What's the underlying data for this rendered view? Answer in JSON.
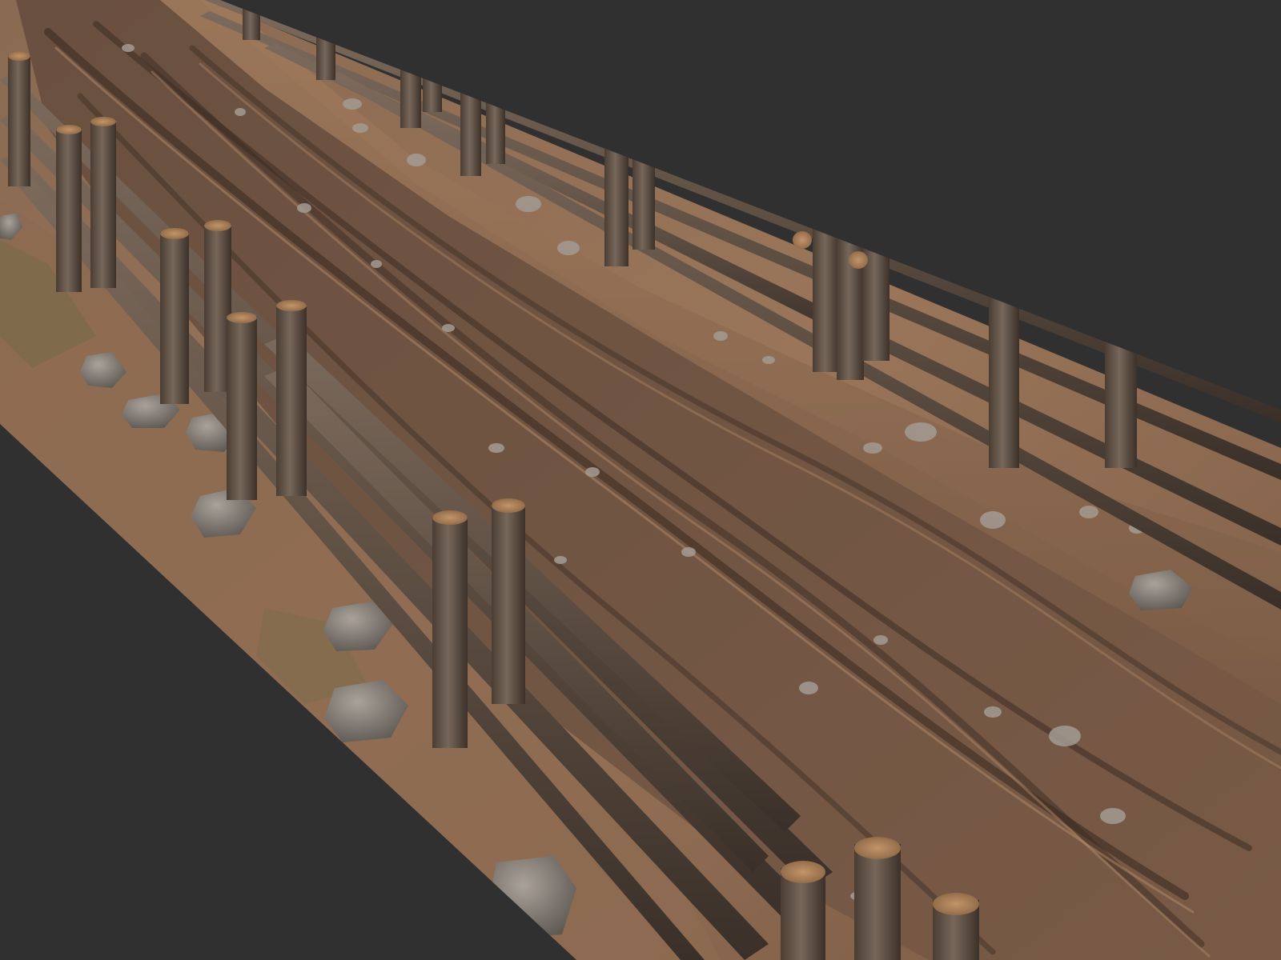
{
  "scene": {
    "subject": "muddy-trail-with-wooden-rail-fences",
    "colors": {
      "background": "#303030",
      "ground_light": "#9a7559",
      "ground_mid": "#7e5d46",
      "ground_dark": "#4e3a2c",
      "mud_channel": "#6f5342",
      "rut_dark": "#3c2c22",
      "wood_light": "#7b6a5c",
      "wood_mid": "#5f5044",
      "wood_dark": "#3a3029",
      "wood_end_grain": "#b58a5e",
      "stone_light": "#a39b93",
      "stone_dark": "#5f5954",
      "moss": "#6b6a44"
    }
  }
}
